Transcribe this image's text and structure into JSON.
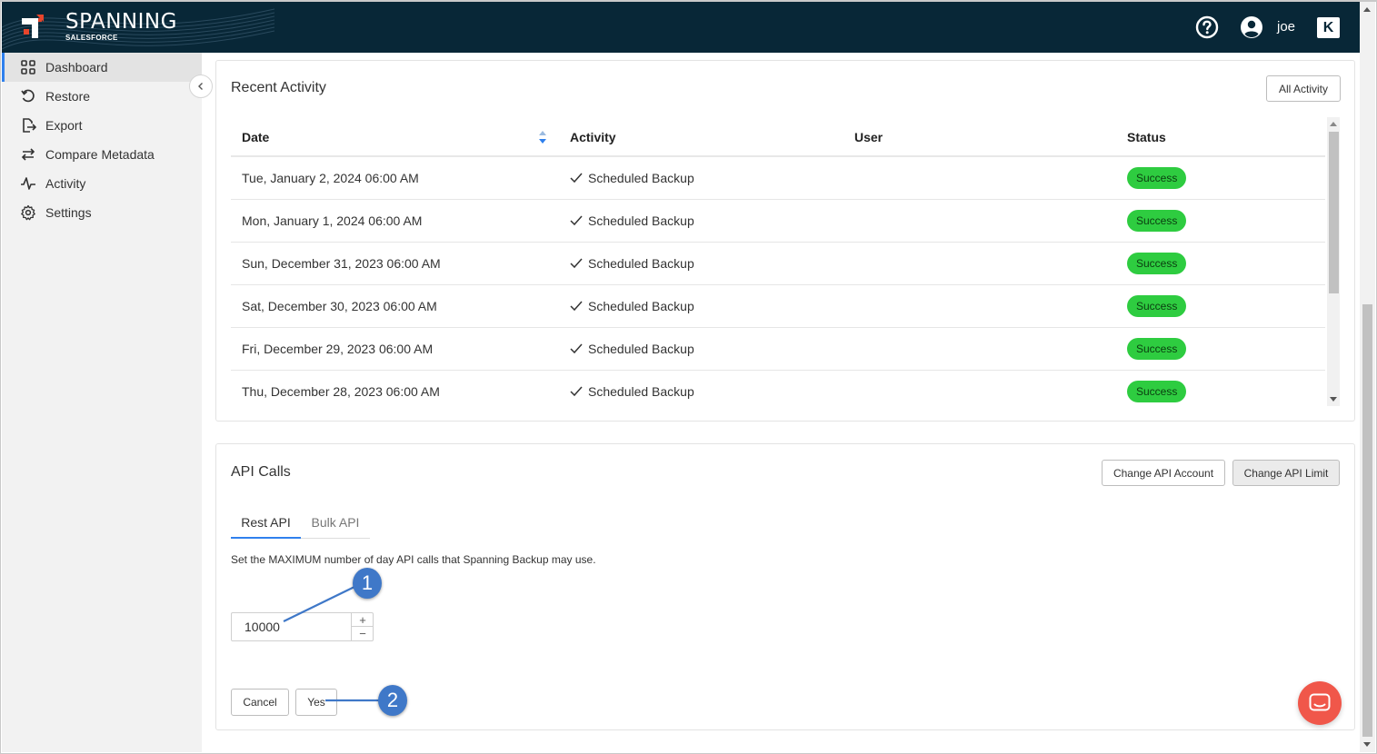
{
  "header": {
    "logo_text": "SPANNING",
    "logo_sub": "SALESFORCE",
    "username": "joe",
    "brand_badge": "K"
  },
  "sidebar": {
    "items": [
      {
        "label": "Dashboard",
        "icon": "grid-icon",
        "active": true
      },
      {
        "label": "Restore",
        "icon": "restore-icon"
      },
      {
        "label": "Export",
        "icon": "export-icon"
      },
      {
        "label": "Compare Metadata",
        "icon": "compare-arrows-icon"
      },
      {
        "label": "Activity",
        "icon": "activity-pulse-icon"
      },
      {
        "label": "Settings",
        "icon": "gear-icon"
      }
    ]
  },
  "recent_activity": {
    "title": "Recent Activity",
    "all_activity_label": "All Activity",
    "columns": [
      "Date",
      "Activity",
      "User",
      "Status"
    ],
    "rows": [
      {
        "date": "Tue, January 2, 2024 06:00 AM",
        "activity": "Scheduled Backup",
        "user": "",
        "status": "Success"
      },
      {
        "date": "Mon, January 1, 2024 06:00 AM",
        "activity": "Scheduled Backup",
        "user": "",
        "status": "Success"
      },
      {
        "date": "Sun, December 31, 2023 06:00 AM",
        "activity": "Scheduled Backup",
        "user": "",
        "status": "Success"
      },
      {
        "date": "Sat, December 30, 2023 06:00 AM",
        "activity": "Scheduled Backup",
        "user": "",
        "status": "Success"
      },
      {
        "date": "Fri, December 29, 2023 06:00 AM",
        "activity": "Scheduled Backup",
        "user": "",
        "status": "Success"
      },
      {
        "date": "Thu, December 28, 2023 06:00 AM",
        "activity": "Scheduled Backup",
        "user": "",
        "status": "Success"
      }
    ]
  },
  "api_calls": {
    "title": "API Calls",
    "change_account_label": "Change API Account",
    "change_limit_label": "Change API Limit",
    "tabs": [
      {
        "label": "Rest API",
        "active": true
      },
      {
        "label": "Bulk API",
        "active": false
      }
    ],
    "description": "Set the MAXIMUM number of day API calls that Spanning Backup may use.",
    "limit_value": "10000",
    "cancel_label": "Cancel",
    "yes_label": "Yes"
  },
  "callouts": [
    "1",
    "2"
  ],
  "colors": {
    "header_bg": "#082737",
    "accent": "#2f80ed",
    "success": "#2ecc40",
    "callout": "#3f78c8",
    "chat": "#f0574a",
    "logo_red": "#e8452c"
  }
}
